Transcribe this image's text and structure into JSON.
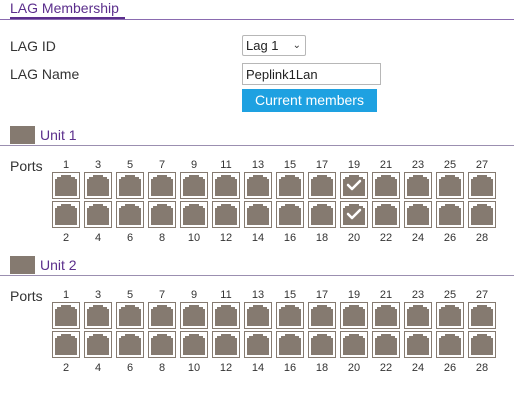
{
  "section": {
    "title": "LAG Membership"
  },
  "form": {
    "lag_id_label": "LAG ID",
    "lag_id_value": "Lag 1",
    "lag_name_label": "LAG Name",
    "lag_name_value": "Peplink1Lan",
    "current_members_button": "Current members"
  },
  "units": [
    {
      "label": "Unit 1",
      "ports_label": "Ports",
      "odd_ports": [
        "1",
        "3",
        "5",
        "7",
        "9",
        "11",
        "13",
        "15",
        "17",
        "19",
        "21",
        "23",
        "25",
        "27"
      ],
      "even_ports": [
        "2",
        "4",
        "6",
        "8",
        "10",
        "12",
        "14",
        "16",
        "18",
        "20",
        "22",
        "24",
        "26",
        "28"
      ],
      "selected_ports": [
        "19",
        "20"
      ]
    },
    {
      "label": "Unit 2",
      "ports_label": "Ports",
      "odd_ports": [
        "1",
        "3",
        "5",
        "7",
        "9",
        "11",
        "13",
        "15",
        "17",
        "19",
        "21",
        "23",
        "25",
        "27"
      ],
      "even_ports": [
        "2",
        "4",
        "6",
        "8",
        "10",
        "12",
        "14",
        "16",
        "18",
        "20",
        "22",
        "24",
        "26",
        "28"
      ],
      "selected_ports": []
    }
  ],
  "colors": {
    "accent": "#5b2e8c",
    "button": "#1ea1e1",
    "port": "#857a70"
  },
  "icons": {
    "unit": "switch-unit-icon",
    "selected": "checkmark-icon"
  }
}
